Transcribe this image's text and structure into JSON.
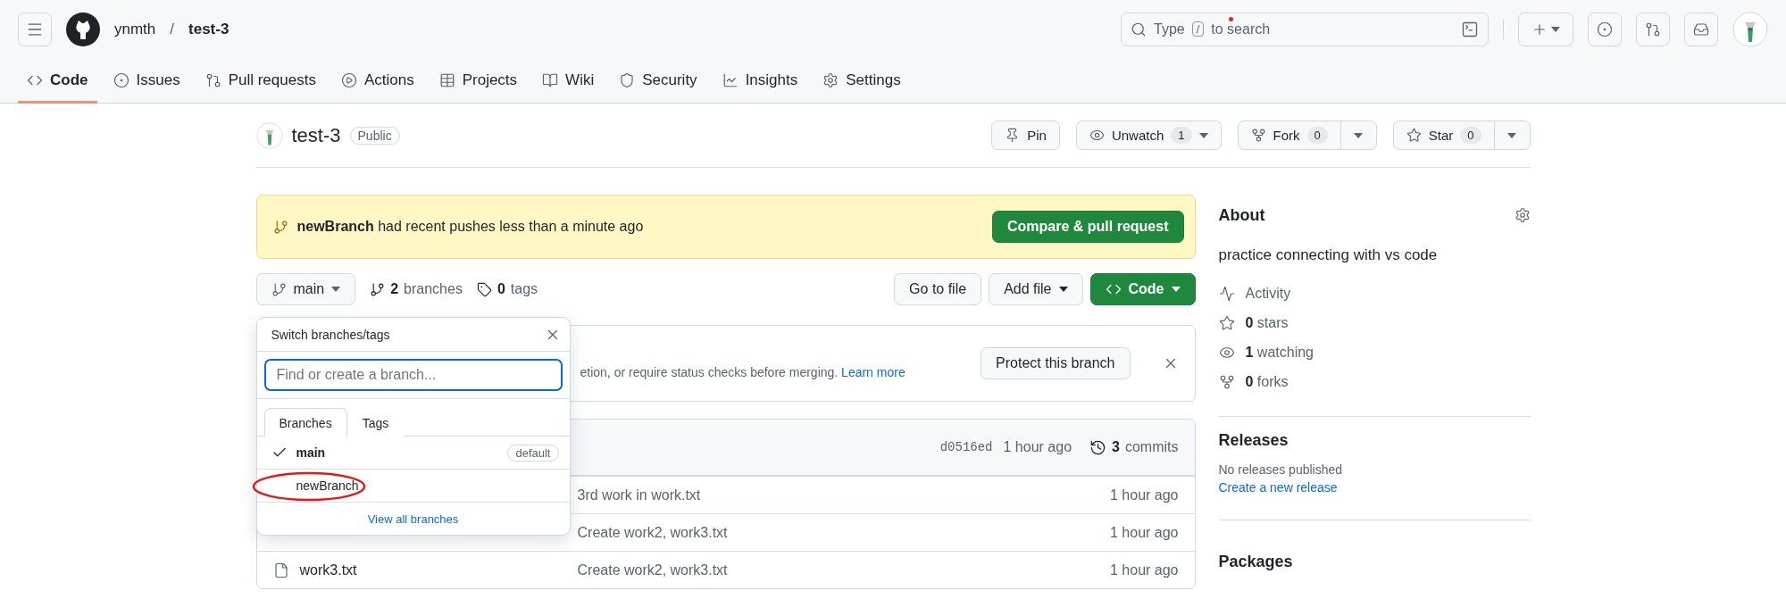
{
  "header": {
    "owner": "ynmth",
    "separator": "/",
    "repo": "test-3",
    "search": {
      "before": "Type",
      "key": "/",
      "after": "to search"
    }
  },
  "repo_nav": [
    {
      "label": "Code",
      "kind": "code",
      "selected": true
    },
    {
      "label": "Issues",
      "kind": "issues",
      "selected": false
    },
    {
      "label": "Pull requests",
      "kind": "pulls",
      "selected": false
    },
    {
      "label": "Actions",
      "kind": "actions",
      "selected": false
    },
    {
      "label": "Projects",
      "kind": "projects",
      "selected": false
    },
    {
      "label": "Wiki",
      "kind": "wiki",
      "selected": false
    },
    {
      "label": "Security",
      "kind": "security",
      "selected": false
    },
    {
      "label": "Insights",
      "kind": "insights",
      "selected": false
    },
    {
      "label": "Settings",
      "kind": "settings",
      "selected": false
    }
  ],
  "repo": {
    "name": "test-3",
    "visibility": "Public"
  },
  "repo_actions": [
    {
      "kind": "pin",
      "label": "Pin"
    },
    {
      "kind": "watch",
      "label": "Unwatch",
      "count": "1"
    },
    {
      "kind": "fork",
      "label": "Fork",
      "count": "0"
    },
    {
      "kind": "star",
      "label": "Star",
      "count": "0"
    }
  ],
  "banner": {
    "branch": "newBranch",
    "message": "had recent pushes less than a minute ago",
    "button": "Compare & pull request"
  },
  "branch_bar": {
    "current": "main",
    "branches_count": "2",
    "branches_label": "branches",
    "tags_count": "0",
    "tags_label": "tags",
    "go_to_file": "Go to file",
    "add_file": "Add file",
    "code": "Code"
  },
  "protect_notice": {
    "text": "etion, or require status checks before merging.",
    "link": "Learn more",
    "button": "Protect this branch"
  },
  "files": {
    "latest_commit": {
      "sha": "d0516ed",
      "time": "1 hour ago",
      "commits_count": "3",
      "commits_label": "commits"
    },
    "rows": [
      {
        "message": "3rd work in work.txt",
        "time": "1 hour ago"
      },
      {
        "message": "Create work2, work3.txt",
        "time": "1 hour ago"
      },
      {
        "name": "work3.txt",
        "message": "Create work2, work3.txt",
        "time": "1 hour ago"
      }
    ]
  },
  "branch_menu": {
    "title": "Switch branches/tags",
    "filter_placeholder": "Find or create a branch...",
    "tabs": [
      {
        "label": "Branches",
        "selected": true
      },
      {
        "label": "Tags",
        "selected": false
      }
    ],
    "branches": [
      {
        "name": "main",
        "checked": true,
        "badge": "default",
        "annotated": false
      },
      {
        "name": "newBranch",
        "checked": false,
        "annotated": true
      }
    ],
    "footer_link": "View all branches"
  },
  "about": {
    "title": "About",
    "description": "practice connecting with vs code",
    "stats": [
      {
        "kind": "activity",
        "label": "Activity"
      },
      {
        "kind": "stars",
        "count": "0",
        "label": "stars"
      },
      {
        "kind": "watching",
        "count": "1",
        "label": "watching"
      },
      {
        "kind": "forks",
        "count": "0",
        "label": "forks"
      }
    ]
  },
  "releases": {
    "title": "Releases",
    "empty": "No releases published",
    "link": "Create a new release"
  },
  "packages": {
    "title": "Packages"
  }
}
